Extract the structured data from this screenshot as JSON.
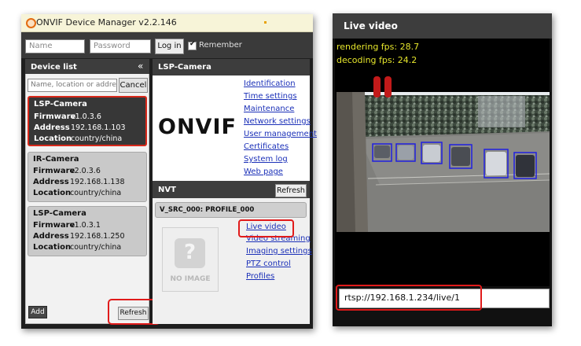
{
  "odm": {
    "title": "ONVIF Device Manager v2.2.146",
    "login": {
      "name_placeholder": "Name",
      "password_placeholder": "Password",
      "login_label": "Log in",
      "remember_label": "Remember"
    },
    "device_list": {
      "title": "Device list",
      "collapse_glyph": "«",
      "search_placeholder": "Name, location or address",
      "cancel_label": "Cancel",
      "labels": {
        "firmware": "Firmware",
        "address": "Address",
        "location": "Location"
      },
      "devices": [
        {
          "name": "LSP-Camera",
          "firmware": "v1.0.3.6",
          "address": "192.168.1.103",
          "location": "country/china"
        },
        {
          "name": "IR-Camera",
          "firmware": "v2.0.3.6",
          "address": "192.168.1.138",
          "location": "country/china"
        },
        {
          "name": "LSP-Camera",
          "firmware": "v1.0.3.1",
          "address": "192.168.1.250",
          "location": "country/china"
        }
      ],
      "add_label": "Add",
      "refresh_label": "Refresh"
    },
    "camera": {
      "title": "LSP-Camera",
      "logo_text": "ONVIF",
      "links": [
        "Identification",
        "Time settings",
        "Maintenance",
        "Network settings",
        "User management",
        "Certificates",
        "System log",
        "Web page"
      ]
    },
    "nvt": {
      "title": "NVT",
      "refresh_label": "Refresh",
      "profile": "V_SRC_000: PROFILE_000",
      "no_image": "NO IMAGE",
      "no_image_glyph": "?",
      "links": [
        "Live video",
        "Video streaming",
        "Imaging settings",
        "PTZ control",
        "Profiles"
      ]
    }
  },
  "live": {
    "title": "Live video",
    "rendering_fps": "rendering fps: 28.7",
    "decoding_fps": "decoding fps: 24.2",
    "rtsp_url": "rtsp://192.168.1.234/live/1"
  },
  "colors": {
    "highlight": "#e11b1b",
    "link": "#1b30b8",
    "fps_text": "#e6e62c",
    "detection_box": "#2020e0"
  }
}
